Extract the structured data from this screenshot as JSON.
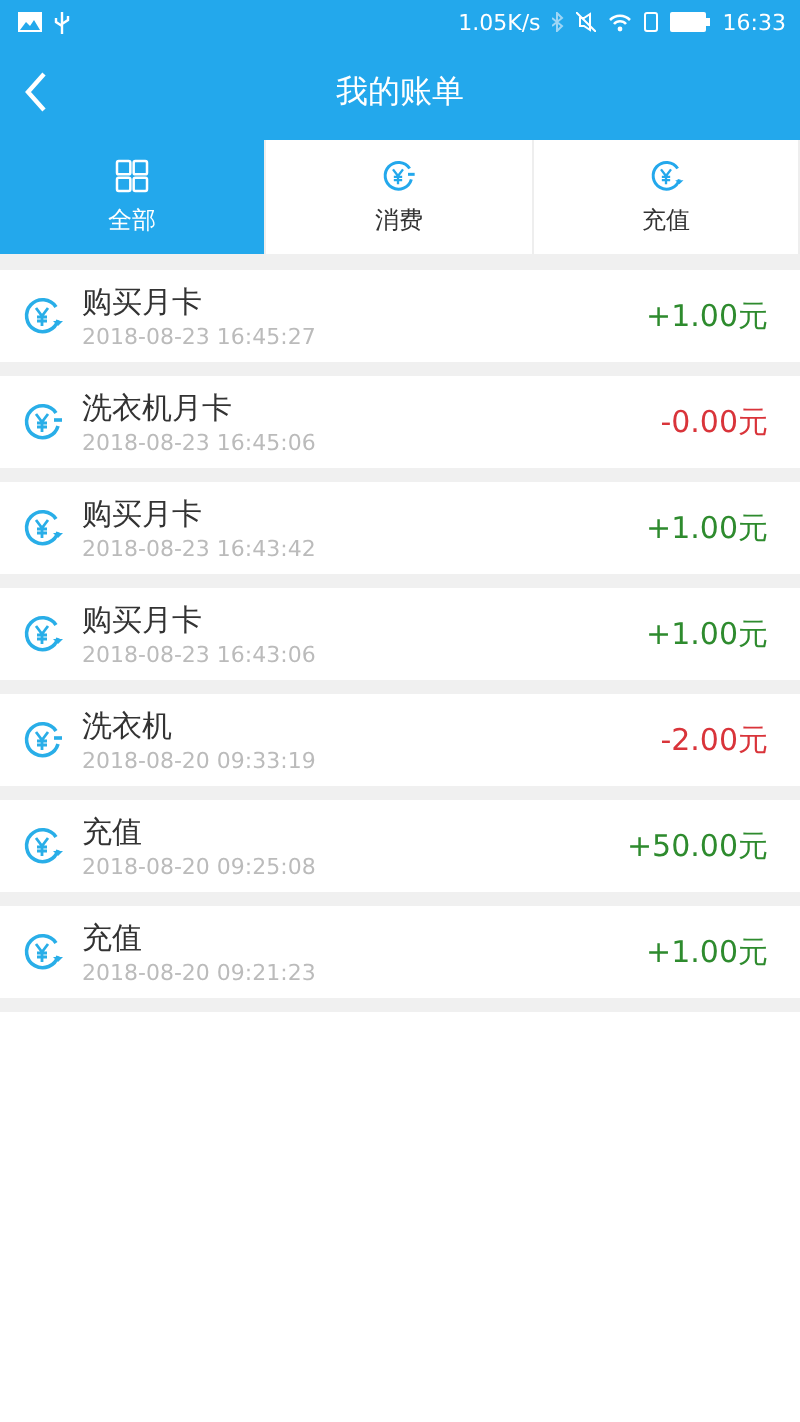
{
  "status_bar": {
    "speed": "1.05K/s",
    "time": "16:33"
  },
  "header": {
    "title": "我的账单"
  },
  "tabs": [
    {
      "label": "全部",
      "kind": "all",
      "selected": true
    },
    {
      "label": "消费",
      "kind": "expense",
      "selected": false
    },
    {
      "label": "充值",
      "kind": "income",
      "selected": false
    }
  ],
  "bills": [
    {
      "name": "购买月卡",
      "time": "2018-08-23 16:45:27",
      "amount": "+1.00元",
      "kind": "income"
    },
    {
      "name": "洗衣机月卡",
      "time": "2018-08-23 16:45:06",
      "amount": "-0.00元",
      "kind": "expense"
    },
    {
      "name": "购买月卡",
      "time": "2018-08-23 16:43:42",
      "amount": "+1.00元",
      "kind": "income"
    },
    {
      "name": "购买月卡",
      "time": "2018-08-23 16:43:06",
      "amount": "+1.00元",
      "kind": "income"
    },
    {
      "name": "洗衣机",
      "time": "2018-08-20 09:33:19",
      "amount": "-2.00元",
      "kind": "expense"
    },
    {
      "name": "充值",
      "time": "2018-08-20 09:25:08",
      "amount": "+50.00元",
      "kind": "income"
    },
    {
      "name": "充值",
      "time": "2018-08-20 09:21:23",
      "amount": "+1.00元",
      "kind": "income"
    }
  ]
}
